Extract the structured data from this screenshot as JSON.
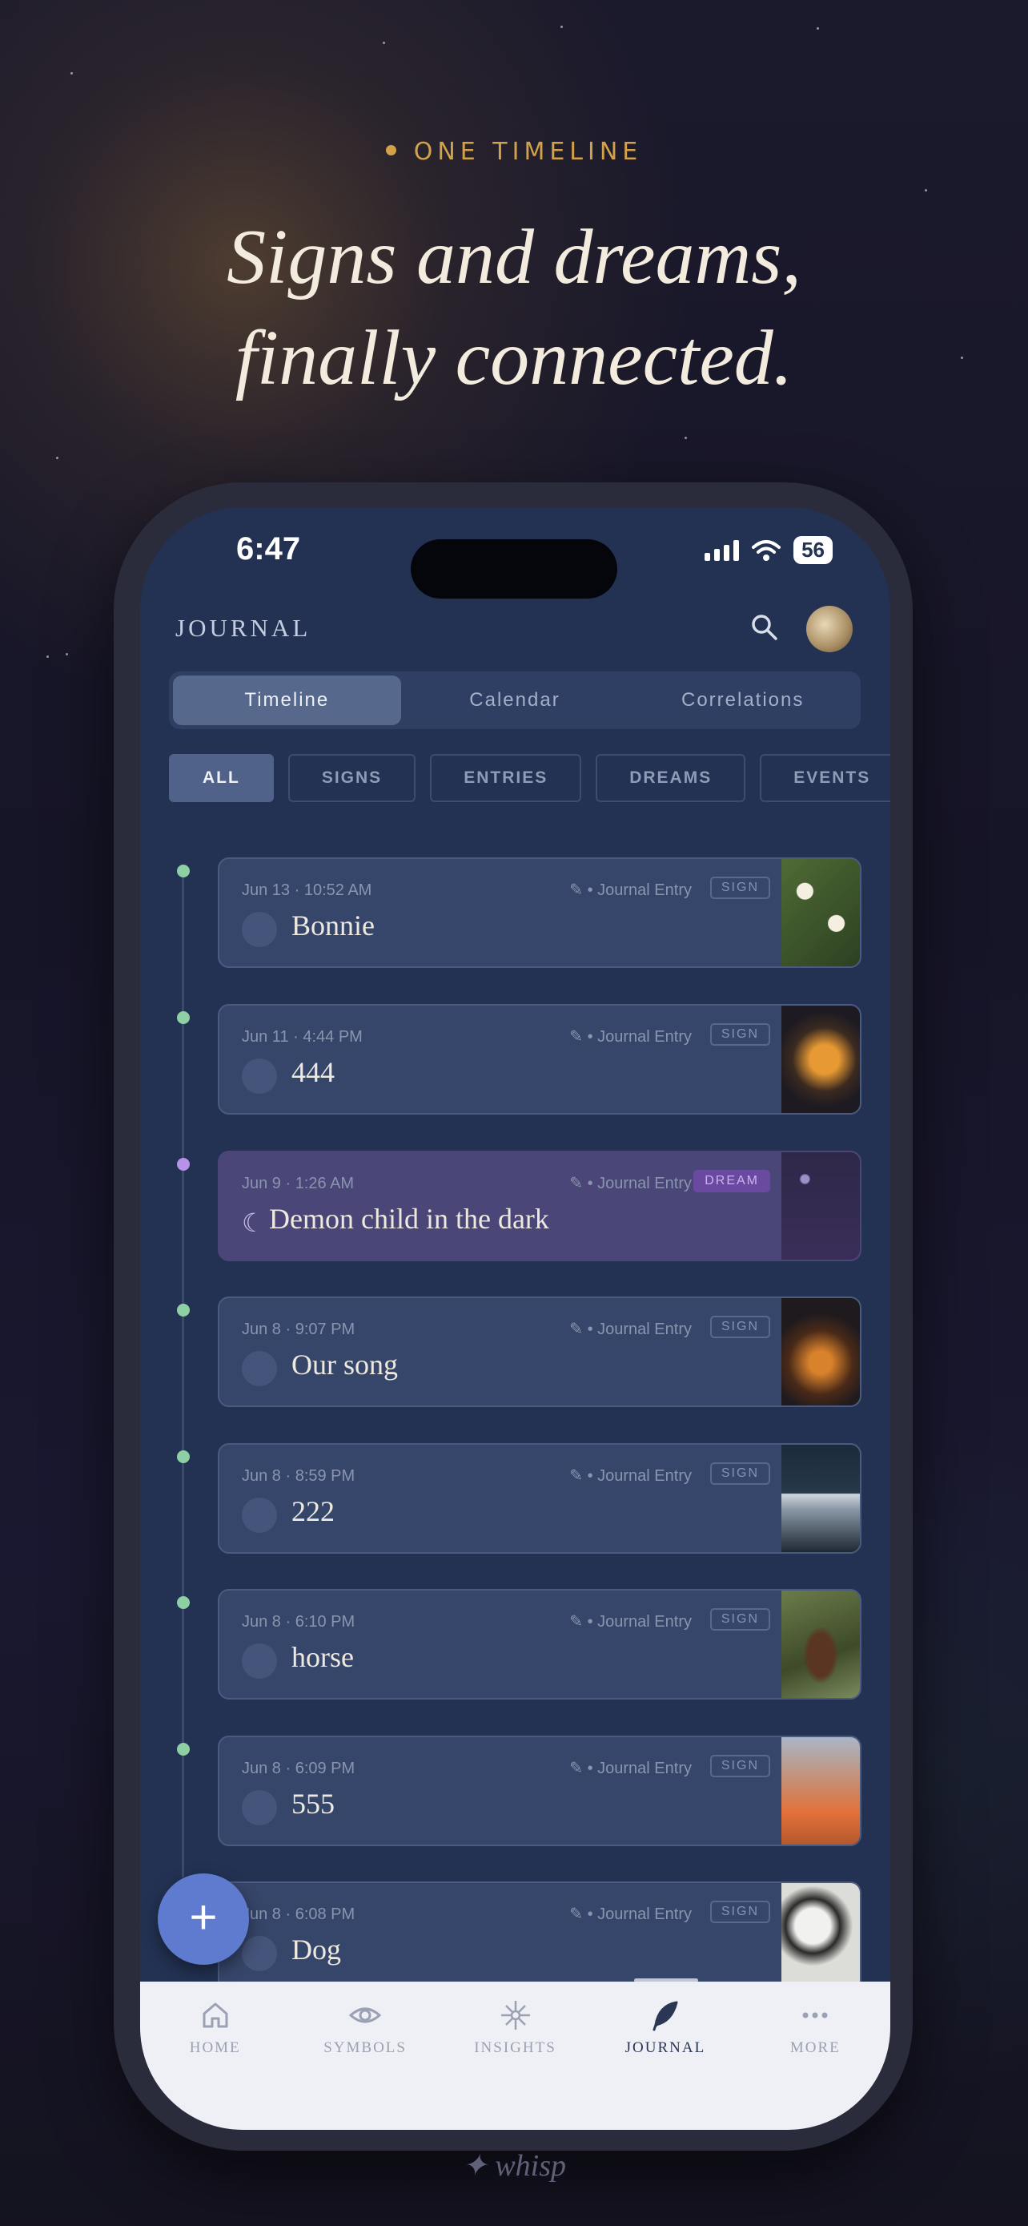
{
  "hero": {
    "eyebrow": "ONE TIMELINE",
    "headline_line1": "Signs and dreams,",
    "headline_line2": "finally connected."
  },
  "status_bar": {
    "time": "6:47",
    "battery": "56"
  },
  "header": {
    "title": "JOURNAL",
    "search_icon": "search-icon",
    "avatar": "avatar"
  },
  "segmented": {
    "items": [
      "Timeline",
      "Calendar",
      "Correlations"
    ],
    "active": "Timeline"
  },
  "filters": {
    "items": [
      "ALL",
      "SIGNS",
      "ENTRIES",
      "DREAMS",
      "EVENTS"
    ],
    "active": "ALL"
  },
  "entries": [
    {
      "meta": "Jun 13 · 10:52 AM",
      "type": "✎ • Journal Entry",
      "tag": "SIGN",
      "title": "Bonnie",
      "kind": "sign"
    },
    {
      "meta": "Jun 11 · 4:44 PM",
      "type": "✎ • Journal Entry",
      "tag": "SIGN",
      "title": "444",
      "kind": "sign"
    },
    {
      "meta": "Jun 9 · 1:26 AM",
      "type": "✎ • Journal Entry",
      "tag": "DREAM",
      "title": "Demon child in the dark",
      "kind": "dream"
    },
    {
      "meta": "Jun 8 · 9:07 PM",
      "type": "✎ • Journal Entry",
      "tag": "SIGN",
      "title": "Our song",
      "kind": "sign"
    },
    {
      "meta": "Jun 8 · 8:59 PM",
      "type": "✎ • Journal Entry",
      "tag": "SIGN",
      "title": "222",
      "kind": "sign"
    },
    {
      "meta": "Jun 8 · 6:10 PM",
      "type": "✎ • Journal Entry",
      "tag": "SIGN",
      "title": "horse",
      "kind": "sign"
    },
    {
      "meta": "Jun 8 · 6:09 PM",
      "type": "✎ • Journal Entry",
      "tag": "SIGN",
      "title": "555",
      "kind": "sign"
    },
    {
      "meta": "Jun 8 · 6:08 PM",
      "type": "✎ • Journal Entry",
      "tag": "SIGN",
      "title": "Dog",
      "kind": "sign"
    }
  ],
  "fab": {
    "label": "+"
  },
  "bottom_nav": [
    {
      "label": "HOME",
      "icon": "home-icon"
    },
    {
      "label": "SYMBOLS",
      "icon": "eye-icon"
    },
    {
      "label": "INSIGHTS",
      "icon": "sparkle-icon"
    },
    {
      "label": "JOURNAL",
      "icon": "feather-icon",
      "active": true
    },
    {
      "label": "MORE",
      "icon": "more-icon"
    }
  ],
  "footer": {
    "brand": "✦ whisp"
  },
  "colors": {
    "accent_gold": "#d2a24a",
    "screen_bg": "#233253",
    "sign_dot": "#8ecfa4",
    "dream_dot": "#b892e8",
    "fab": "#5e7bd0"
  }
}
